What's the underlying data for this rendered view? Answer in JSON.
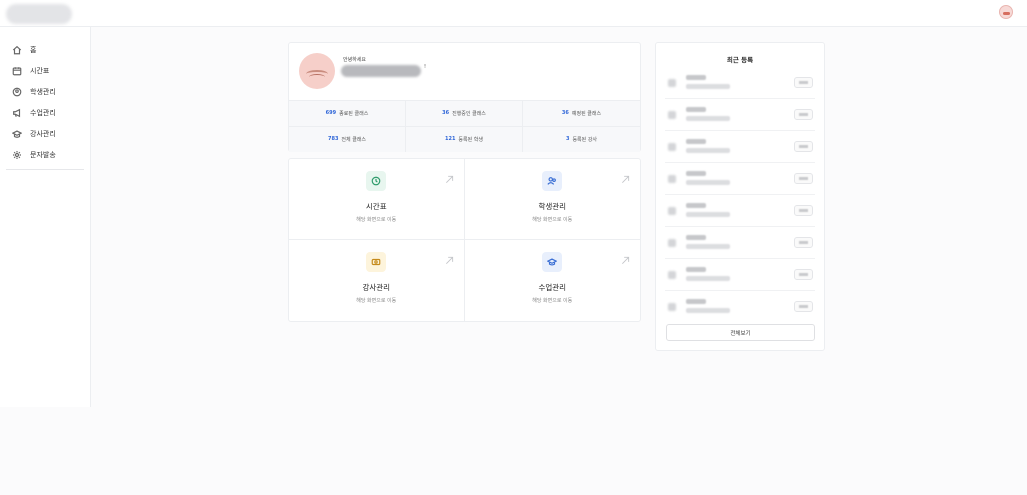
{
  "topbar": {
    "logo": "logo",
    "avatar": "user-avatar"
  },
  "sidebar": {
    "items": [
      {
        "label": "홈",
        "icon": "home-icon"
      },
      {
        "label": "시간표",
        "icon": "calendar-icon"
      },
      {
        "label": "학생관리",
        "icon": "student-icon"
      },
      {
        "label": "수업관리",
        "icon": "megaphone-icon"
      },
      {
        "label": "강사관리",
        "icon": "teacher-icon"
      },
      {
        "label": "문자발송",
        "icon": "settings-icon"
      }
    ]
  },
  "profile": {
    "greeting": "안녕하세요",
    "suffix": "!"
  },
  "stats": [
    {
      "value": "699",
      "label": "종료된 클래스"
    },
    {
      "value": "36",
      "label": "진행중인 클래스"
    },
    {
      "value": "36",
      "label": "예정된 클래스"
    },
    {
      "value": "783",
      "label": "전체 클래스"
    },
    {
      "value": "121",
      "label": "등록된 학생"
    },
    {
      "value": "3",
      "label": "등록된 강사"
    }
  ],
  "nav_cards": [
    {
      "title": "시간표",
      "subtitle": "해당 화면으로 이동",
      "icon": "clock-icon",
      "icon_bg": "#e8f6ef",
      "icon_color": "#2e9b6a"
    },
    {
      "title": "학생관리",
      "subtitle": "해당 화면으로 이동",
      "icon": "users-icon",
      "icon_bg": "#e8effc",
      "icon_color": "#3b6fd4"
    },
    {
      "title": "강사관리",
      "subtitle": "해당 화면으로 이동",
      "icon": "money-icon",
      "icon_bg": "#fdf4dc",
      "icon_color": "#c58a1b"
    },
    {
      "title": "수업관리",
      "subtitle": "해당 화면으로 이동",
      "icon": "graduation-cap-icon",
      "icon_bg": "#e8effc",
      "icon_color": "#3b6fd4"
    }
  ],
  "recent": {
    "title": "최근 등록",
    "rows": 8,
    "view_all": "전체보기"
  }
}
